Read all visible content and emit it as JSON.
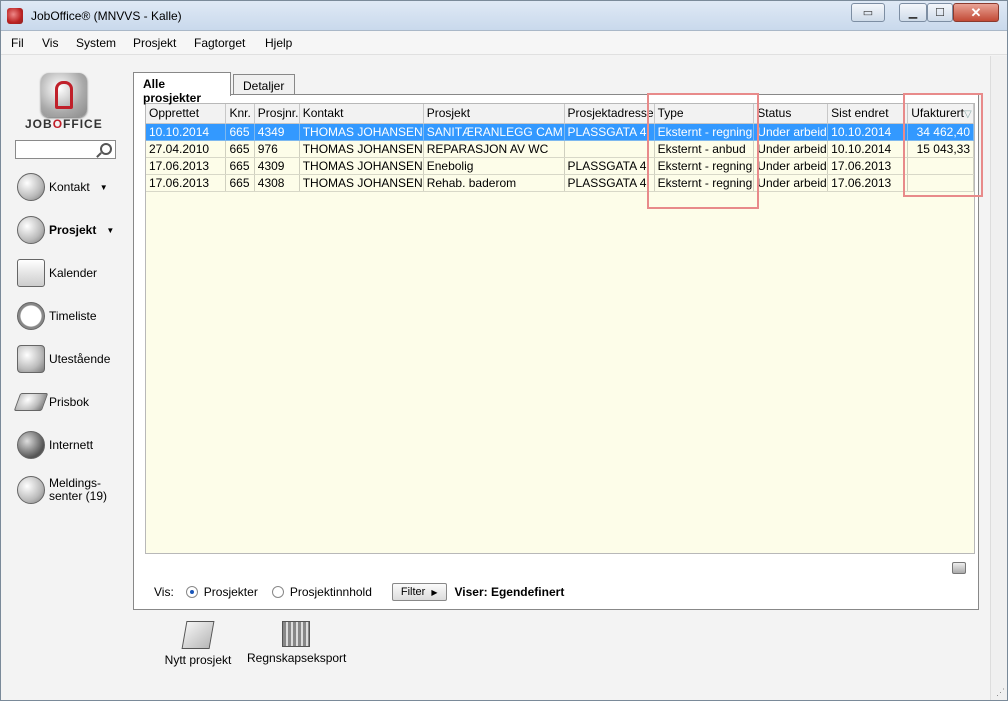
{
  "window": {
    "title": "JobOffice®   (MNVVS - Kalle)",
    "controls": {
      "minimize": "▁",
      "maximize": "☐",
      "close": "✕"
    }
  },
  "menu": [
    "Fil",
    "Vis",
    "System",
    "Prosjekt",
    "Fagtorget",
    "Hjelp"
  ],
  "logo": {
    "text_a": "JOB",
    "text_o": "O",
    "text_b": "FFICE"
  },
  "search": {
    "placeholder": ""
  },
  "nav": [
    {
      "label": "Kontakt",
      "icon": "contacts-icon",
      "has_dropdown": true
    },
    {
      "label": "Prosjekt",
      "icon": "project-icon",
      "has_dropdown": true,
      "active": true
    },
    {
      "label": "Kalender",
      "icon": "calendar-icon"
    },
    {
      "label": "Timeliste",
      "icon": "clock-icon"
    },
    {
      "label": "Utestående",
      "icon": "cash-register-icon"
    },
    {
      "label": "Prisbok",
      "icon": "book-icon"
    },
    {
      "label": "Internett",
      "icon": "globe-icon"
    },
    {
      "label": "Meldings-",
      "label2": "senter (19)",
      "icon": "sync-icon"
    }
  ],
  "tabs": {
    "all": "Alle prosjekter",
    "details": "Detaljer"
  },
  "grid": {
    "columns": [
      "Opprettet",
      "Knr.",
      "Prosjnr.",
      "Kontakt",
      "Prosjekt",
      "Prosjektadresse",
      "Type",
      "Status",
      "Sist endret",
      "Ufakturert"
    ],
    "sort_indicator": "▽",
    "rows": [
      {
        "selected": true,
        "cells": [
          "10.10.2014",
          "665",
          "4349",
          "THOMAS JOHANSEN",
          "SANITÆRANLEGG CAM",
          "PLASSGATA 4",
          "Eksternt - regning",
          "Under arbeid",
          "10.10.2014",
          "34 462,40"
        ]
      },
      {
        "selected": false,
        "cells": [
          "27.04.2010",
          "665",
          "976",
          "THOMAS JOHANSEN",
          "REPARASJON AV WC",
          "",
          "Eksternt - anbud",
          "Under arbeid",
          "10.10.2014",
          "15 043,33"
        ]
      },
      {
        "selected": false,
        "cells": [
          "17.06.2013",
          "665",
          "4309",
          "THOMAS JOHANSEN",
          "Enebolig",
          "PLASSGATA 4",
          "Eksternt - regning",
          "Under arbeid",
          "17.06.2013",
          ""
        ]
      },
      {
        "selected": false,
        "cells": [
          "17.06.2013",
          "665",
          "4308",
          "THOMAS JOHANSEN",
          "Rehab. baderom",
          "PLASSGATA 4",
          "Eksternt - regning",
          "Under arbeid",
          "17.06.2013",
          ""
        ]
      }
    ]
  },
  "footer": {
    "vis_label": "Vis:",
    "option_projects": "Prosjekter",
    "option_content": "Prosjektinnhold",
    "filter_button": "Filter",
    "filter_arrow": "▶",
    "showing": "Viser: Egendefinert"
  },
  "actions": {
    "new_project": "Nytt prosjekt",
    "accounting_export": "Regnskapseksport"
  }
}
